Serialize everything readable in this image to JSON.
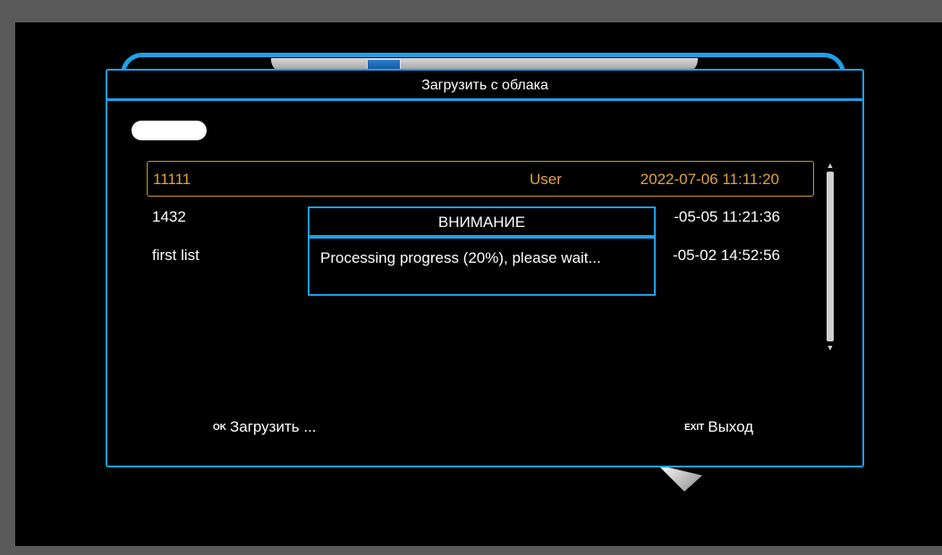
{
  "window": {
    "title": "Загрузить с облака"
  },
  "list": {
    "rows": [
      {
        "name": "11111",
        "type": "User",
        "date": "2022-07-06 11:11:20",
        "selected": true
      },
      {
        "name": "1432",
        "type": "",
        "date": "-05-05 11:21:36",
        "selected": false
      },
      {
        "name": "first list",
        "type": "",
        "date": "-05-02 14:52:56",
        "selected": false
      }
    ]
  },
  "footer": {
    "ok_key": "OK",
    "ok_label": "Загрузить ...",
    "exit_key": "EXIT",
    "exit_label": "Выход"
  },
  "dialog": {
    "title": "ВНИМАНИЕ",
    "message": "Processing progress (20%), please wait..."
  },
  "colors": {
    "accent": "#1ea0e8",
    "selected": "#e0a43a",
    "background": "#000000"
  }
}
